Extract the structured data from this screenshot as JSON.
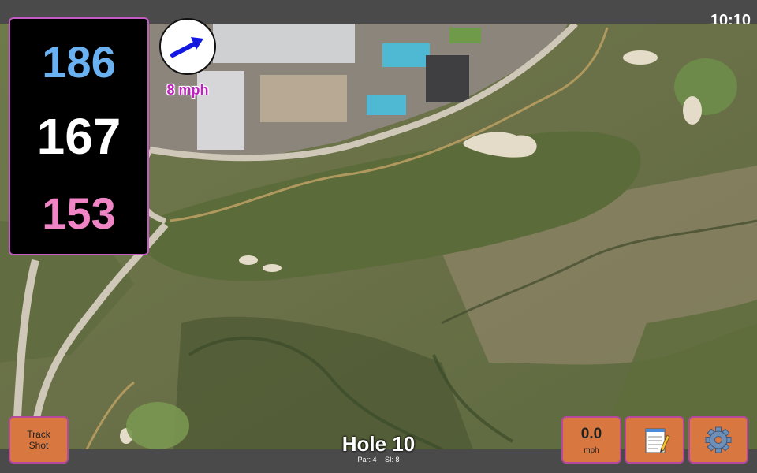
{
  "status": {
    "time": "10:10"
  },
  "distances": {
    "back": "186",
    "middle": "167",
    "front": "153"
  },
  "wind": {
    "speed": "8 mph",
    "icon": "arrow-right-up-icon",
    "arrow_color": "#1218e0"
  },
  "hole": {
    "title": "Hole 10",
    "par": "Par: 4",
    "si": "SI: 8"
  },
  "buttons": {
    "track_line1": "Track",
    "track_line2": "Shot",
    "speed_value": "0.0",
    "speed_unit": "mph",
    "notes_icon": "notepad-icon",
    "settings_icon": "gear-icon"
  },
  "colors": {
    "button_bg": "#d8773f",
    "button_border": "#b5479e",
    "back_distance": "#6ab1f2",
    "middle_distance": "#ffffff",
    "front_distance": "#f085c5",
    "wind_text": "#c11fc1"
  }
}
